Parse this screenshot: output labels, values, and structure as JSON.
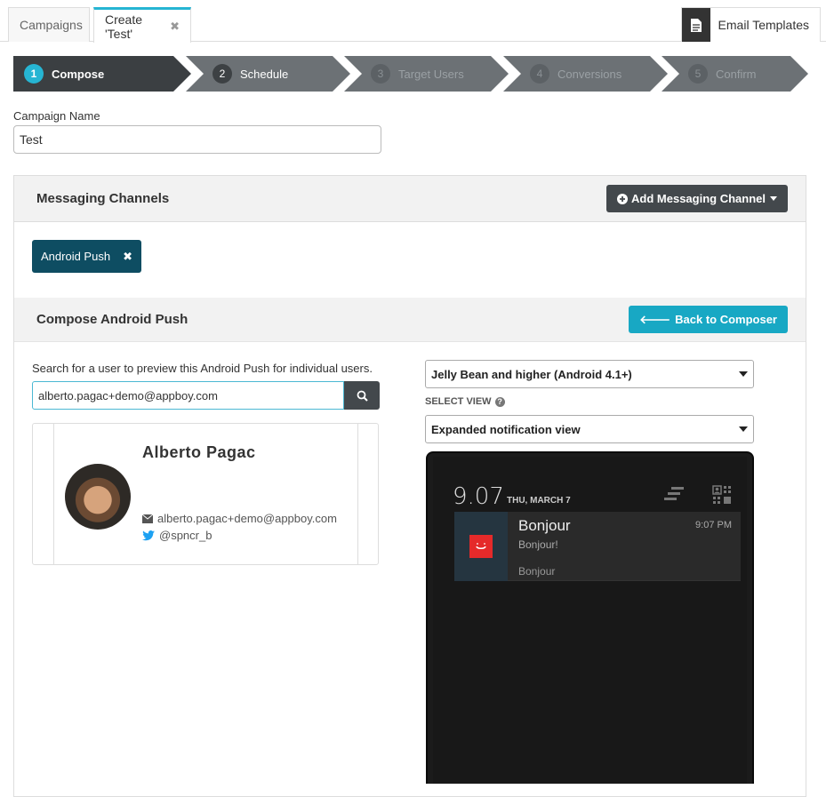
{
  "tabs": [
    {
      "label": "Campaigns"
    },
    {
      "label": "Create 'Test'"
    }
  ],
  "email_templates": {
    "label": "Email Templates"
  },
  "steps": [
    {
      "num": "1",
      "label": "Compose"
    },
    {
      "num": "2",
      "label": "Schedule"
    },
    {
      "num": "3",
      "label": "Target Users"
    },
    {
      "num": "4",
      "label": "Conversions"
    },
    {
      "num": "5",
      "label": "Confirm"
    }
  ],
  "campaign": {
    "name_label": "Campaign Name",
    "name_value": "Test"
  },
  "messaging": {
    "title": "Messaging Channels",
    "add_button": "Add Messaging Channel",
    "chip": "Android Push"
  },
  "compose": {
    "title": "Compose Android Push",
    "back_button": "Back to Composer",
    "search_hint": "Search for a user to preview this Android Push for individual users.",
    "search_value": "alberto.pagac+demo@appboy.com"
  },
  "user": {
    "name": "Alberto Pagac",
    "email": "alberto.pagac+demo@appboy.com",
    "twitter": "@spncr_b"
  },
  "preview": {
    "version_select": "Jelly Bean and higher (Android 4.1+)",
    "view_label": "SELECT VIEW",
    "view_select": "Expanded notification view"
  },
  "phone": {
    "time": "9.07",
    "date": "THU, MARCH 7",
    "notif_title": "Bonjour",
    "notif_time": "9:07 PM",
    "notif_body": "Bonjour!",
    "notif_summary": "Bonjour"
  },
  "colors": {
    "accent": "#26b5d3",
    "chip": "#0e4d62",
    "dark": "#43484c"
  }
}
